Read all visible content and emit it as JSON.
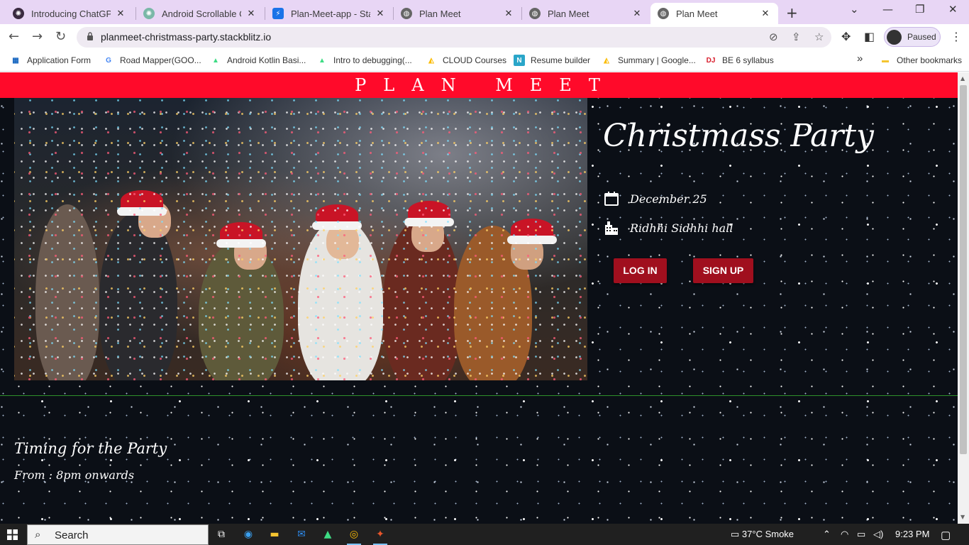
{
  "browser": {
    "tabs": [
      {
        "title": "Introducing ChatGPT",
        "icon": "chatgpt-icon"
      },
      {
        "title": "Android Scrollable Co",
        "icon": "chatgpt-icon"
      },
      {
        "title": "Plan-Meet-app - Stack",
        "icon": "stackblitz-icon"
      },
      {
        "title": "Plan Meet",
        "icon": "globe-icon"
      },
      {
        "title": "Plan Meet",
        "icon": "globe-icon"
      },
      {
        "title": "Plan Meet",
        "icon": "globe-icon",
        "active": true
      }
    ],
    "new_tab": "+",
    "url": "planmeet-christmass-party.stackblitz.io",
    "profile_label": "Paused",
    "bookmarks": [
      {
        "label": "Application Form"
      },
      {
        "label": "Road Mapper(GOO..."
      },
      {
        "label": "Android Kotlin Basi..."
      },
      {
        "label": "Intro to debugging(..."
      },
      {
        "label": "CLOUD Courses"
      },
      {
        "label": "Resume builder"
      },
      {
        "label": "Summary | Google..."
      },
      {
        "label": "BE 6 syllabus"
      }
    ],
    "bookmarks_more": "»",
    "other_bookmarks": "Other bookmarks"
  },
  "page": {
    "brand": "PLAN MEET",
    "event_title": "Christmass Party",
    "date": "December 25",
    "venue": "Ridhhi Sidhhi hall",
    "login_label": "LOG IN",
    "signup_label": "SIGN UP",
    "timing_title": "Timing for the Party",
    "timing_value": "From : 8pm onwards",
    "colors": {
      "brand_bar": "#ff0a2a",
      "button": "#a00f1e",
      "divider": "#2e8f2a"
    }
  },
  "taskbar": {
    "search_label": "Search",
    "weather": "37°C  Smoke",
    "time": "9:23 PM"
  }
}
